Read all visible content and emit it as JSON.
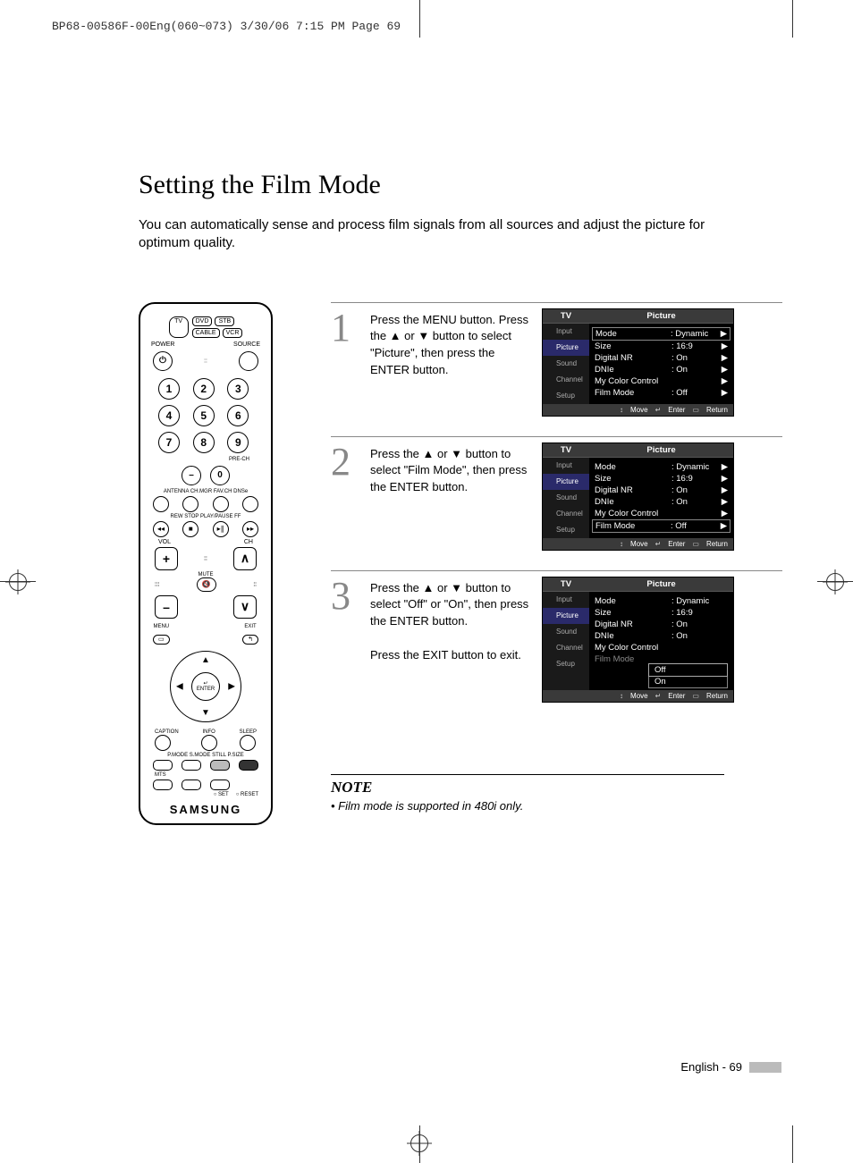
{
  "header_line": "BP68-00586F-00Eng(060~073)  3/30/06  7:15 PM  Page 69",
  "title": "Setting the Film Mode",
  "intro": "You can automatically sense and process film signals from all sources and adjust the picture for optimum quality.",
  "remote": {
    "devices_top": [
      "DVD",
      "STB"
    ],
    "device_tv": "TV",
    "devices_bottom": [
      "CABLE",
      "VCR"
    ],
    "power_label": "POWER",
    "source_label": "SOURCE",
    "numbers": [
      "1",
      "2",
      "3",
      "4",
      "5",
      "6",
      "7",
      "8",
      "9"
    ],
    "prech": "PRE-CH",
    "dash": "–",
    "zero": "0",
    "row_labels_a": "ANTENNA CH.MGR  FAV.CH     DNSe",
    "transport_labels": "REW     STOP   PLAY/PAUSE    FF",
    "vol": "VOL",
    "ch": "CH",
    "mute": "MUTE",
    "menu": "MENU",
    "exit": "EXIT",
    "enter_icon": "↵",
    "enter": "ENTER",
    "caption": "CAPTION",
    "info": "INFO",
    "sleep": "SLEEP",
    "color_labels": "P.MODE  S.MODE   STILL   P.SIZE",
    "mts": "MTS",
    "set": "○ SET",
    "reset": "○ RESET",
    "brand": "SAMSUNG"
  },
  "steps": [
    {
      "num": "1",
      "text": "Press the MENU button. Press the ▲ or ▼ button to select \"Picture\", then press the ENTER button.",
      "osd": {
        "tv": "TV",
        "title": "Picture",
        "sidebar": [
          "Input",
          "Picture",
          "Sound",
          "Channel",
          "Setup"
        ],
        "active_index": 1,
        "rows": [
          {
            "k": "Mode",
            "v": ": Dynamic",
            "arr": "▶",
            "boxed": true
          },
          {
            "k": "Size",
            "v": ": 16:9",
            "arr": "▶"
          },
          {
            "k": "Digital NR",
            "v": ": On",
            "arr": "▶"
          },
          {
            "k": "DNIe",
            "v": ": On",
            "arr": "▶"
          },
          {
            "k": "My Color Control",
            "v": "",
            "arr": "▶"
          },
          {
            "k": "Film Mode",
            "v": ": Off",
            "arr": "▶"
          }
        ],
        "footer": [
          "Move",
          "Enter",
          "Return"
        ]
      }
    },
    {
      "num": "2",
      "text": "Press the ▲ or ▼ button to select \"Film Mode\", then press the ENTER button.",
      "osd": {
        "tv": "TV",
        "title": "Picture",
        "sidebar": [
          "Input",
          "Picture",
          "Sound",
          "Channel",
          "Setup"
        ],
        "active_index": 1,
        "rows": [
          {
            "k": "Mode",
            "v": ": Dynamic",
            "arr": "▶"
          },
          {
            "k": "Size",
            "v": ": 16:9",
            "arr": "▶"
          },
          {
            "k": "Digital NR",
            "v": ": On",
            "arr": "▶"
          },
          {
            "k": "DNIe",
            "v": ": On",
            "arr": "▶"
          },
          {
            "k": "My Color Control",
            "v": "",
            "arr": "▶"
          },
          {
            "k": "Film Mode",
            "v": ": Off",
            "arr": "▶",
            "boxed": true
          }
        ],
        "footer": [
          "Move",
          "Enter",
          "Return"
        ]
      }
    },
    {
      "num": "3",
      "text": "Press the ▲ or ▼ button to select \"Off\" or \"On\", then press the ENTER button.\n\nPress the EXIT button to exit.",
      "osd": {
        "tv": "TV",
        "title": "Picture",
        "sidebar": [
          "Input",
          "Picture",
          "Sound",
          "Channel",
          "Setup"
        ],
        "active_index": 1,
        "rows": [
          {
            "k": "Mode",
            "v": ": Dynamic",
            "arr": "",
            "dim": false
          },
          {
            "k": "Size",
            "v": ": 16:9",
            "arr": "",
            "dim": false
          },
          {
            "k": "Digital NR",
            "v": ": On",
            "arr": "",
            "dim": false
          },
          {
            "k": "DNIe",
            "v": ": On",
            "arr": "",
            "dim": false
          },
          {
            "k": "My Color Control",
            "v": "",
            "arr": "",
            "dim": false
          },
          {
            "k": "Film Mode",
            "v": "",
            "arr": "",
            "dim": true
          }
        ],
        "submenu": [
          "Off",
          "On"
        ],
        "submenu_sel": 0,
        "footer": [
          "Move",
          "Enter",
          "Return"
        ]
      }
    }
  ],
  "note_title": "NOTE",
  "note_item": "•  Film mode is supported in 480i only.",
  "footer_text": "English - 69"
}
